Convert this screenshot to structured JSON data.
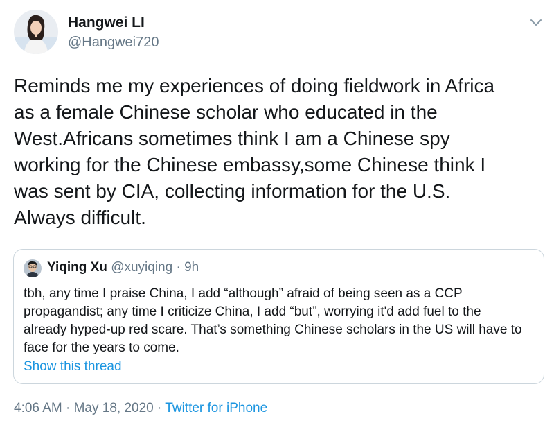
{
  "tweet": {
    "author_name": "Hangwei LI",
    "author_handle": "@Hangwei720",
    "text": "Reminds me my experiences of doing fieldwork in Africa\nas a female Chinese scholar who educated in the\nWest.Africans sometimes think I am a Chinese spy\nworking for the Chinese embassy,some Chinese think I\nwas sent by CIA, collecting information for the U.S.\nAlways difficult.",
    "menu_icon": "chevron-down-icon"
  },
  "quoted": {
    "author_name": "Yiqing Xu",
    "author_handle": "@xuyiqing",
    "separator": "·",
    "age": "9h",
    "text": "tbh, any time I praise China, I add “although” afraid of being seen as a CCP\npropagandist; any time I criticize China, I add “but”, worrying it'd add fuel to the\nalready hyped-up red scare. That’s something Chinese scholars in the US will have to\nface for the years to come.",
    "show_thread": "Show this thread"
  },
  "footer": {
    "time": "4:06 AM",
    "sep1": "·",
    "date": "May 18, 2020",
    "sep2": "·",
    "source": "Twitter for iPhone"
  },
  "colors": {
    "text": "#14171a",
    "muted": "#657786",
    "link": "#1b95e0",
    "border": "#ccd6dd"
  }
}
